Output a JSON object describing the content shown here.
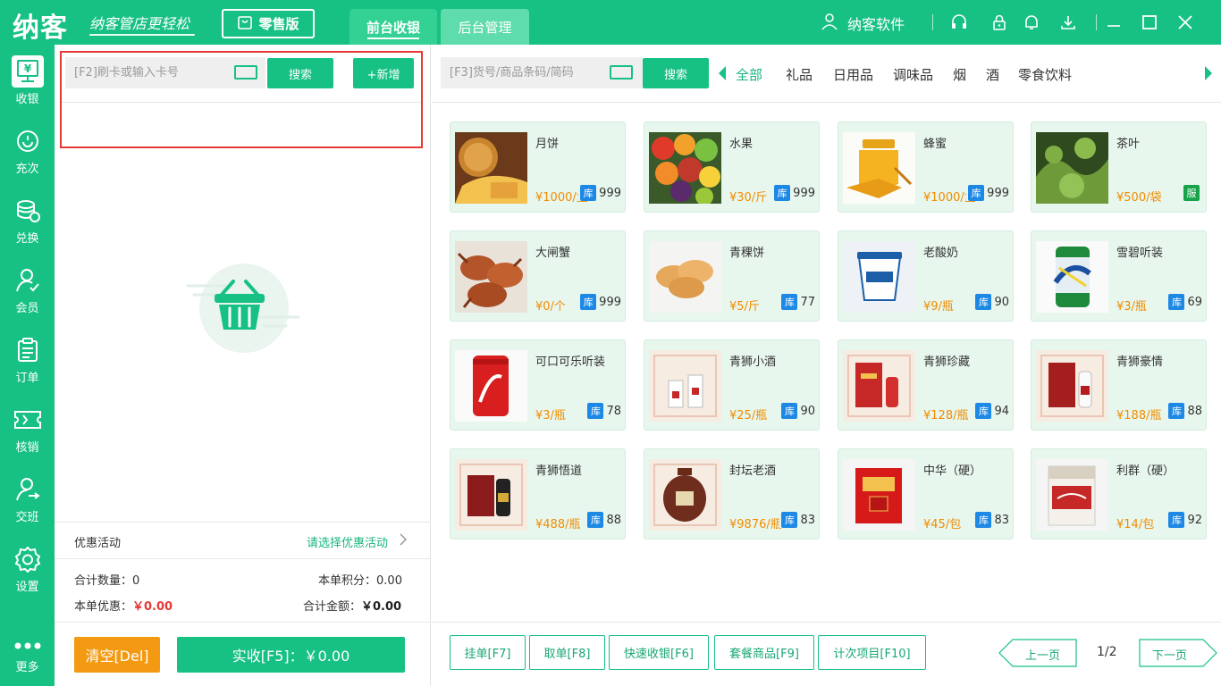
{
  "app": {
    "logo": "纳客",
    "slogan": "纳客管店更轻松",
    "edition": "零售版",
    "tabs": [
      "前台收银",
      "后台管理"
    ],
    "user": "纳客软件"
  },
  "sidebar": [
    {
      "label": "收银",
      "icon": "cashier-icon"
    },
    {
      "label": "充次",
      "icon": "recharge-icon"
    },
    {
      "label": "兑换",
      "icon": "exchange-icon"
    },
    {
      "label": "会员",
      "icon": "member-icon"
    },
    {
      "label": "订单",
      "icon": "order-icon"
    },
    {
      "label": "核销",
      "icon": "verify-icon"
    },
    {
      "label": "交班",
      "icon": "shift-icon"
    },
    {
      "label": "设置",
      "icon": "settings-icon"
    },
    {
      "label": "更多",
      "icon": "more-icon"
    }
  ],
  "left": {
    "card_placeholder": "[F2]刷卡或输入卡号",
    "search_label": "搜索",
    "add_label": "+新增",
    "promo_label": "优惠活动",
    "promo_link": "请选择优惠活动",
    "total_qty_label": "合计数量：",
    "total_qty": "0",
    "points_label": "本单积分：",
    "points": "0.00",
    "discount_label": "本单优惠：",
    "discount": "￥0.00",
    "total_amount_label": "合计金额：",
    "total_amount": "￥0.00",
    "clear_label": "清空[Del]",
    "pay_label": "实收[F5]：￥0.00"
  },
  "right": {
    "goods_placeholder": "[F3]货号/商品条码/简码",
    "search_label": "搜索",
    "categories": [
      "全部",
      "礼品",
      "日用品",
      "调味品",
      "烟",
      "酒",
      "零食饮料"
    ]
  },
  "products": [
    {
      "name": "月饼",
      "price": "¥1000/盒",
      "stock": "999",
      "badge": "库"
    },
    {
      "name": "水果",
      "price": "¥30/斤",
      "stock": "999",
      "badge": "库"
    },
    {
      "name": "蜂蜜",
      "price": "¥1000/盒",
      "stock": "999",
      "badge": "库"
    },
    {
      "name": "茶叶",
      "price": "¥500/袋",
      "stock": "",
      "badge": "服"
    },
    {
      "name": "大闸蟹",
      "price": "¥0/个",
      "stock": "999",
      "badge": "库"
    },
    {
      "name": "青稞饼",
      "price": "¥5/斤",
      "stock": "77",
      "badge": "库"
    },
    {
      "name": "老酸奶",
      "price": "¥9/瓶",
      "stock": "90",
      "badge": "库"
    },
    {
      "name": "雪碧听装",
      "price": "¥3/瓶",
      "stock": "69",
      "badge": "库"
    },
    {
      "name": "可口可乐听装",
      "price": "¥3/瓶",
      "stock": "78",
      "badge": "库"
    },
    {
      "name": "青狮小酒",
      "price": "¥25/瓶",
      "stock": "90",
      "badge": "库"
    },
    {
      "name": "青狮珍藏",
      "price": "¥128/瓶",
      "stock": "94",
      "badge": "库"
    },
    {
      "name": "青狮豪情",
      "price": "¥188/瓶",
      "stock": "88",
      "badge": "库"
    },
    {
      "name": "青狮悟道",
      "price": "¥488/瓶",
      "stock": "88",
      "badge": "库"
    },
    {
      "name": "封坛老酒",
      "price": "¥9876/瓶",
      "stock": "83",
      "badge": "库"
    },
    {
      "name": "中华（硬）",
      "price": "¥45/包",
      "stock": "83",
      "badge": "库"
    },
    {
      "name": "利群（硬）",
      "price": "¥14/包",
      "stock": "92",
      "badge": "库"
    }
  ],
  "footer": {
    "buttons": [
      "挂单[F7]",
      "取单[F8]",
      "快速收银[F6]",
      "套餐商品[F9]",
      "计次项目[F10]"
    ],
    "prev": "上一页",
    "next": "下一页",
    "page": "1/2"
  },
  "colors": {
    "accent": "#17c183",
    "price": "#f08c00",
    "stock_badge": "#1e88e5",
    "service_badge": "#17a34a",
    "clear": "#f39a12",
    "highlight_box": "#e53935"
  }
}
